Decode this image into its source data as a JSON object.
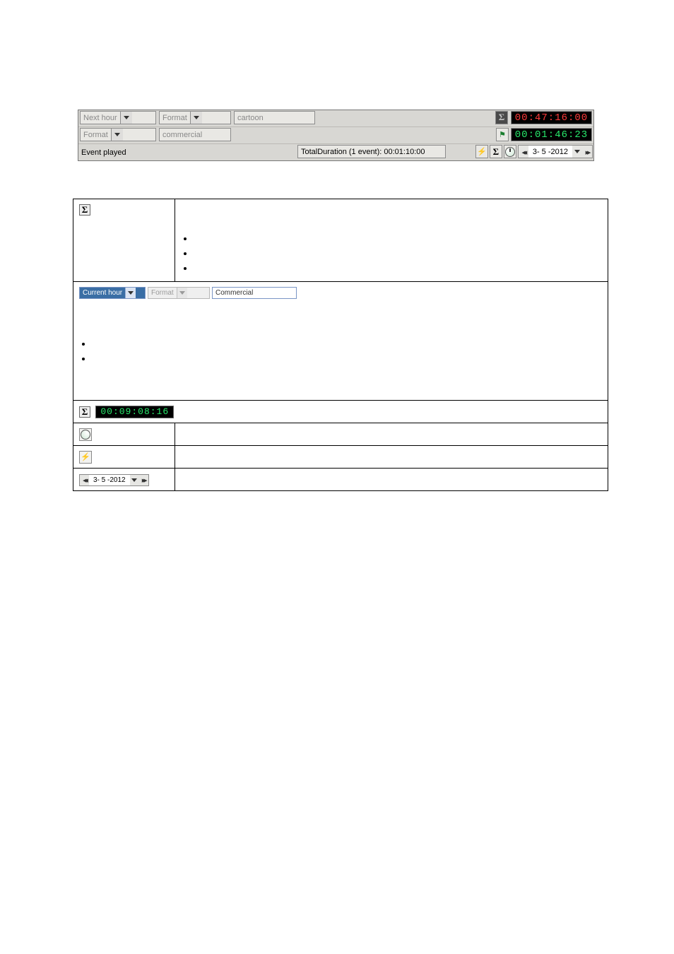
{
  "top": {
    "row1": {
      "dd1": "Next hour",
      "dd2": "Format",
      "field3": "cartoon",
      "sigma": "Σ",
      "tc": "00:47:16:00"
    },
    "row2": {
      "dd1": "Format",
      "field2": "commercial",
      "flag_icon": "flag-icon",
      "tc": "00:01:46:23"
    },
    "row3": {
      "status": "Event played",
      "total": "TotalDuration (1 event): 00:01:10:00",
      "date": "3- 5 -2012"
    }
  },
  "doc": {
    "row1": {
      "sigma": "Σ"
    },
    "row2": {
      "combo1": "Current hour",
      "combo2": "Format",
      "text3": "Commercial"
    },
    "row3": {
      "sigma": "Σ",
      "tc": "00:09:08:16"
    },
    "row4": {
      "icon": "sweep-icon"
    },
    "row5": {
      "icon": "bolt-icon"
    },
    "row6": {
      "date": "3- 5 -2012"
    }
  }
}
